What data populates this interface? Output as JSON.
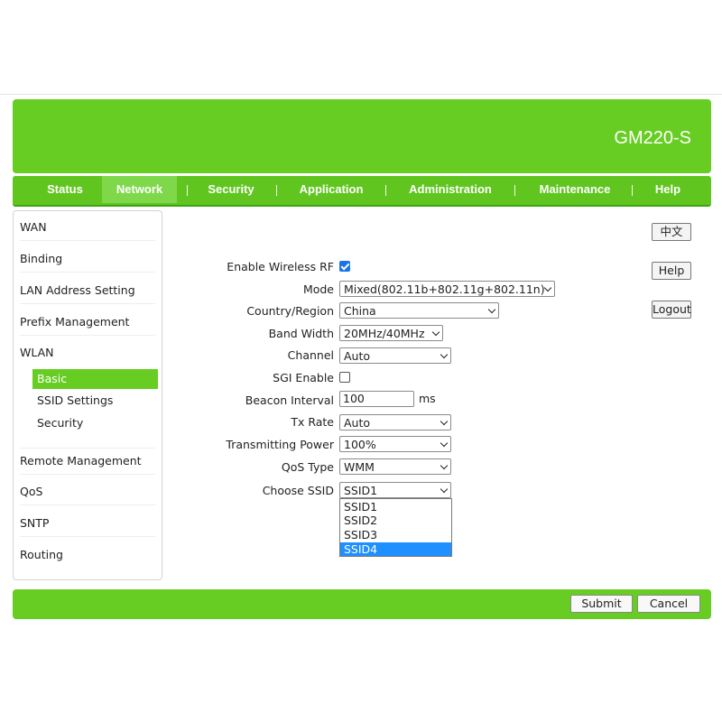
{
  "header": {
    "brand": "GM220-S"
  },
  "nav": {
    "items": [
      {
        "label": "Status"
      },
      {
        "label": "Network",
        "active": true
      },
      {
        "label": "Security"
      },
      {
        "label": "Application"
      },
      {
        "label": "Administration"
      },
      {
        "label": "Maintenance"
      },
      {
        "label": "Help"
      }
    ]
  },
  "sidebar": {
    "items": [
      "WAN",
      "Binding",
      "LAN Address Setting",
      "Prefix Management",
      "WLAN"
    ],
    "wlan_sub": [
      "Basic",
      "SSID Settings",
      "Security"
    ],
    "items_after": [
      "Remote Management",
      "QoS",
      "SNTP",
      "Routing"
    ]
  },
  "side_buttons": {
    "language": "中文",
    "help": "Help",
    "logout": "Logout"
  },
  "form": {
    "enable_rf": {
      "label": "Enable Wireless RF",
      "checked": true
    },
    "mode": {
      "label": "Mode",
      "value": "Mixed(802.11b+802.11g+802.11n)"
    },
    "country": {
      "label": "Country/Region",
      "value": "China"
    },
    "bandwidth": {
      "label": "Band Width",
      "value": "20MHz/40MHz"
    },
    "channel": {
      "label": "Channel",
      "value": "Auto"
    },
    "sgi": {
      "label": "SGI Enable",
      "checked": false
    },
    "beacon": {
      "label": "Beacon Interval",
      "value": "100",
      "unit": "ms"
    },
    "tx_rate": {
      "label": "Tx Rate",
      "value": "Auto"
    },
    "tx_power": {
      "label": "Transmitting Power",
      "value": "100%"
    },
    "qos": {
      "label": "QoS Type",
      "value": "WMM"
    },
    "ssid": {
      "label": "Choose SSID",
      "value": "SSID1",
      "options": [
        "SSID1",
        "SSID2",
        "SSID3",
        "SSID4"
      ],
      "highlighted": "SSID4"
    }
  },
  "footer": {
    "submit": "Submit",
    "cancel": "Cancel"
  },
  "colors": {
    "brand_green": "#67cd23",
    "highlight_blue": "#1e90ff",
    "checkbox_blue": "#1a73e8"
  }
}
